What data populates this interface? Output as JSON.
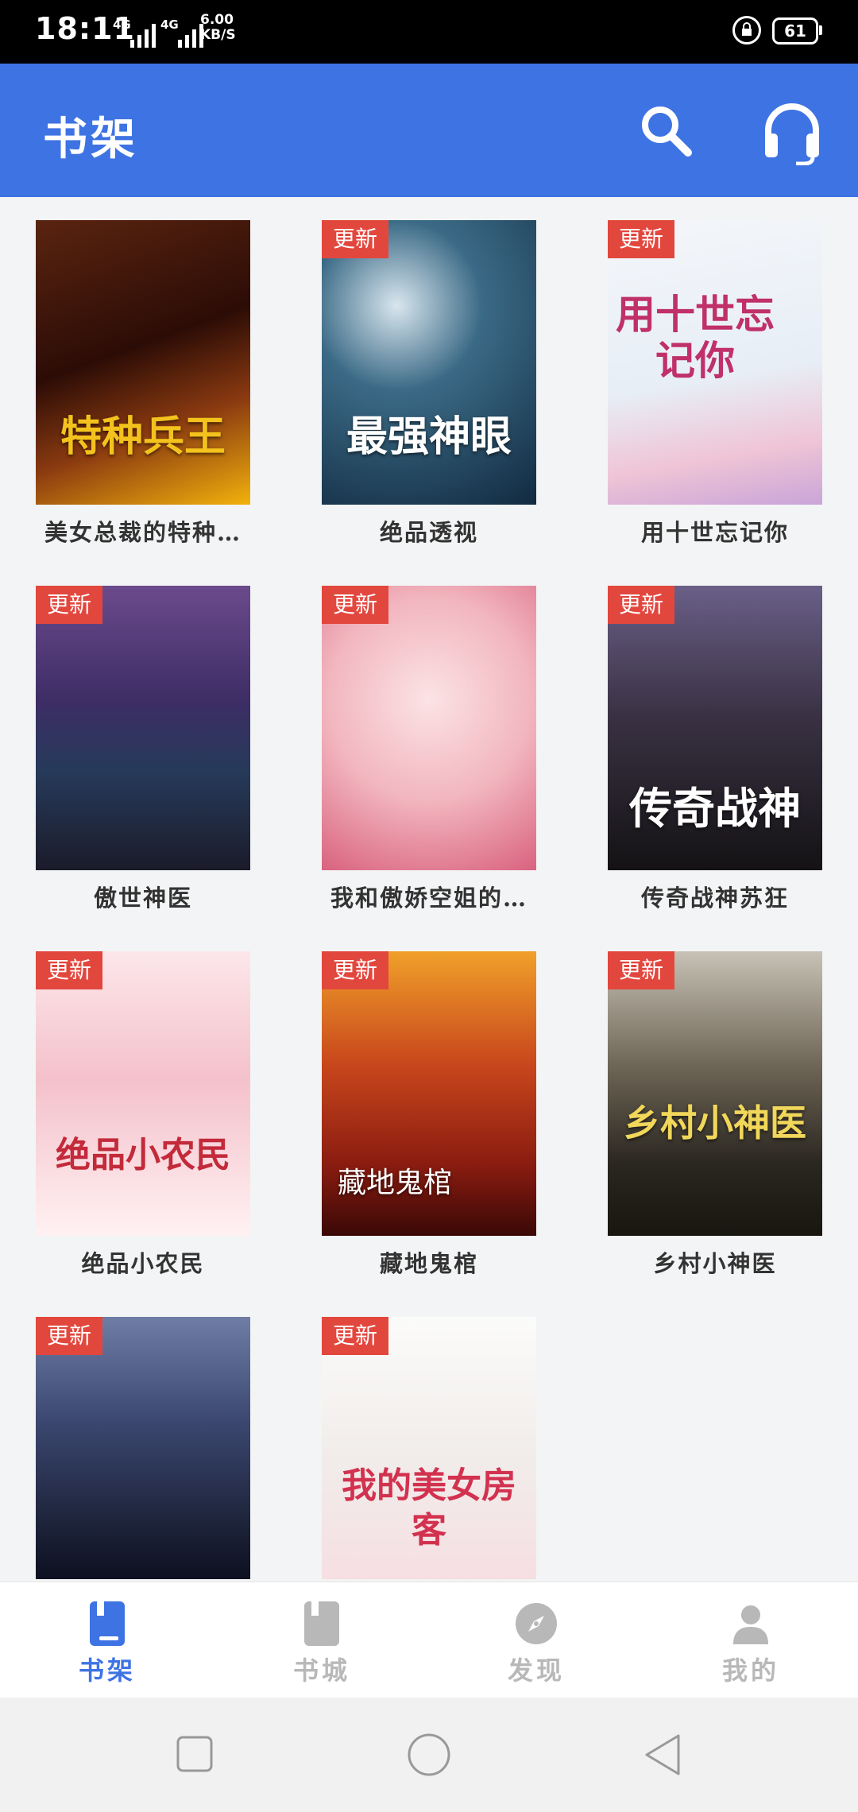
{
  "status_bar": {
    "time": "18:11",
    "network1": "4G",
    "network2": "4G",
    "speed_value": "6.00",
    "speed_unit": "KB/S",
    "battery": "61"
  },
  "header": {
    "title": "书架"
  },
  "badge_label": "更新",
  "books": [
    {
      "title": "美女总裁的特种…",
      "cover_text": "特种兵王",
      "badge": false
    },
    {
      "title": "绝品透视",
      "cover_text": "最强神眼",
      "badge": true
    },
    {
      "title": "用十世忘记你",
      "cover_text": "用十世忘记你",
      "badge": true
    },
    {
      "title": "傲世神医",
      "cover_text": "",
      "badge": true
    },
    {
      "title": "我和傲娇空姐的…",
      "cover_text": "",
      "badge": true
    },
    {
      "title": "传奇战神苏狂",
      "cover_text": "传奇战神",
      "badge": true
    },
    {
      "title": "绝品小农民",
      "cover_text": "绝品小农民",
      "badge": true
    },
    {
      "title": "藏地鬼棺",
      "cover_text": "藏地鬼棺",
      "badge": true
    },
    {
      "title": "乡村小神医",
      "cover_text": "乡村小神医",
      "badge": true
    },
    {
      "title": "",
      "cover_text": "",
      "badge": true
    },
    {
      "title": "",
      "cover_text": "我的美女房客",
      "badge": true
    }
  ],
  "bottom_nav": [
    {
      "label": "书架",
      "icon": "bookshelf-icon",
      "active": true
    },
    {
      "label": "书城",
      "icon": "bookstore-icon",
      "active": false
    },
    {
      "label": "发现",
      "icon": "compass-icon",
      "active": false
    },
    {
      "label": "我的",
      "icon": "person-icon",
      "active": false
    }
  ],
  "colors": {
    "accent": "#3e73e3",
    "badge": "#e2473e",
    "inactive": "#b8b8b8"
  }
}
